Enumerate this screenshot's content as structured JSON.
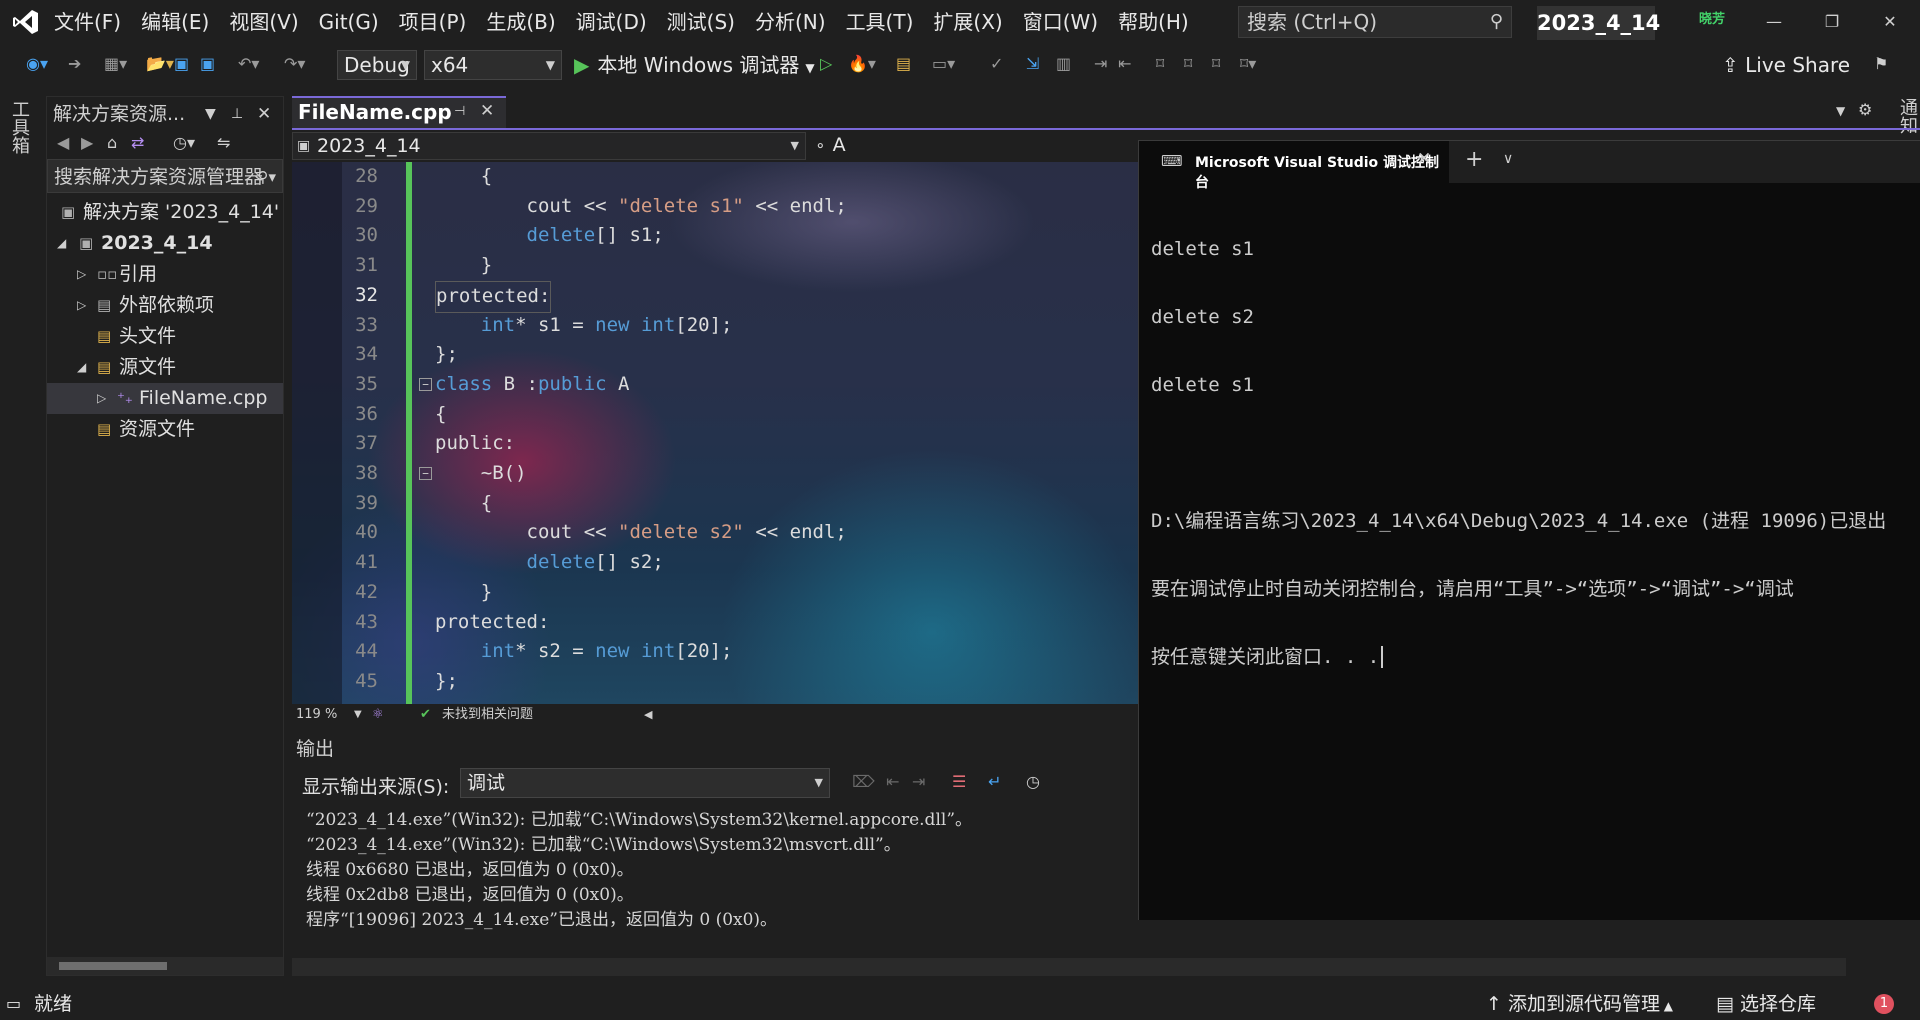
{
  "app": {
    "menus": [
      "文件(F)",
      "编辑(E)",
      "视图(V)",
      "Git(G)",
      "项目(P)",
      "生成(B)",
      "调试(D)",
      "测试(S)",
      "分析(N)",
      "工具(T)",
      "扩展(X)",
      "窗口(W)",
      "帮助(H)"
    ],
    "search_text": "搜索 (Ctrl+Q)",
    "solution_badge": "2023_4_14",
    "user_badge": "晓芳"
  },
  "toolbar": {
    "config": "Debug",
    "platform": "x64",
    "run_label": "本地 Windows 调试器",
    "live_share": "Live Share"
  },
  "side": {
    "toolbox_label": "工具箱",
    "notifications_label": "通知"
  },
  "solution_explorer": {
    "title": "解决方案资源...",
    "search_placeholder": "搜索解决方案资源管理器",
    "items": [
      {
        "label": "解决方案 '2023_4_14'"
      },
      {
        "label": "2023_4_14"
      },
      {
        "label": "引用"
      },
      {
        "label": "外部依赖项"
      },
      {
        "label": "头文件"
      },
      {
        "label": "源文件"
      },
      {
        "label": "FileName.cpp"
      },
      {
        "label": "资源文件"
      }
    ]
  },
  "editor": {
    "tab_name": "FileName.cpp",
    "scope_combo": "2023_4_14",
    "member_combo": "A",
    "zoom": "119 %",
    "issues": "未找到相关问题",
    "current_line": 32,
    "lines": [
      {
        "n": 28,
        "text": "    {"
      },
      {
        "n": 29,
        "text": "        cout << \"delete s1\" << endl;"
      },
      {
        "n": 30,
        "text": "        delete[] s1;"
      },
      {
        "n": 31,
        "text": "    }"
      },
      {
        "n": 32,
        "text": "protected:"
      },
      {
        "n": 33,
        "text": "    int* s1 = new int[20];"
      },
      {
        "n": 34,
        "text": "};"
      },
      {
        "n": 35,
        "text": "class B :public A"
      },
      {
        "n": 36,
        "text": "{"
      },
      {
        "n": 37,
        "text": "public:"
      },
      {
        "n": 38,
        "text": "    ~B()"
      },
      {
        "n": 39,
        "text": "    {"
      },
      {
        "n": 40,
        "text": "        cout << \"delete s2\" << endl;"
      },
      {
        "n": 41,
        "text": "        delete[] s2;"
      },
      {
        "n": 42,
        "text": "    }"
      },
      {
        "n": 43,
        "text": "protected:"
      },
      {
        "n": 44,
        "text": "    int* s2 = new int[20];"
      },
      {
        "n": 45,
        "text": "};"
      }
    ]
  },
  "output": {
    "title": "输出",
    "source_label": "显示输出来源(S):",
    "source_value": "调试",
    "lines": [
      "“2023_4_14.exe”(Win32): 已加载“C:\\Windows\\System32\\kernel.appcore.dll”。",
      "“2023_4_14.exe”(Win32): 已加载“C:\\Windows\\System32\\msvcrt.dll”。",
      "线程 0x6680 已退出，返回值为 0 (0x0)。",
      "线程 0x2db8 已退出，返回值为 0 (0x0)。",
      "程序“[19096] 2023_4_14.exe”已退出，返回值为 0 (0x0)。"
    ]
  },
  "console": {
    "title": "Microsoft Visual Studio 调试控制台",
    "lines": [
      "delete s1",
      "delete s2",
      "delete s1",
      "",
      "D:\\编程语言练习\\2023_4_14\\x64\\Debug\\2023_4_14.exe (进程 19096)已退出",
      "要在调试停止时自动关闭控制台，请启用“工具”->“选项”->“调试”->“调试",
      "按任意键关闭此窗口. . ."
    ]
  },
  "status": {
    "ready": "就绪",
    "add_source_control": "添加到源代码管理",
    "select_repo": "选择仓库",
    "notification_count": "1"
  }
}
